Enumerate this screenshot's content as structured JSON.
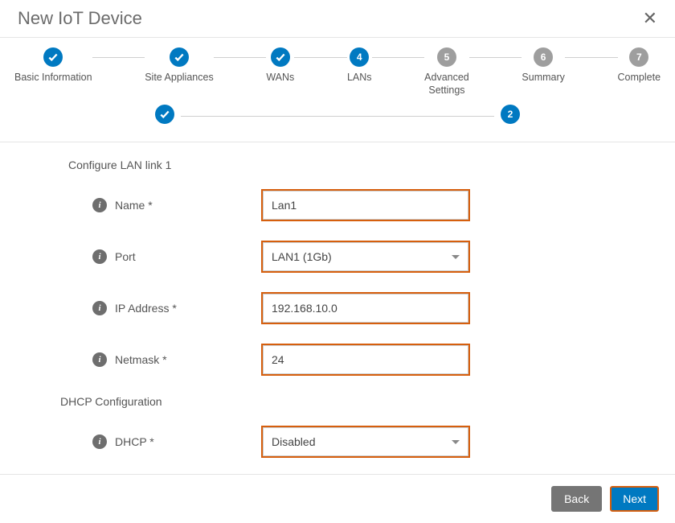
{
  "dialog": {
    "title": "New IoT Device"
  },
  "stepper": {
    "steps": [
      {
        "label": "Basic Information",
        "state": "done"
      },
      {
        "label": "Site Appliances",
        "state": "done"
      },
      {
        "label": "WANs",
        "state": "done"
      },
      {
        "label": "LANs",
        "state": "active",
        "number": "4"
      },
      {
        "label": "Advanced\nSettings",
        "state": "future",
        "number": "5"
      },
      {
        "label": "Summary",
        "state": "future",
        "number": "6"
      },
      {
        "label": "Complete",
        "state": "future",
        "number": "7"
      }
    ]
  },
  "sub_stepper": {
    "step1_state": "done",
    "step2_state": "active",
    "step2_number": "2"
  },
  "form": {
    "section_heading": "Configure LAN link 1",
    "name": {
      "label": "Name *",
      "value": "Lan1"
    },
    "port": {
      "label": "Port",
      "value": "LAN1 (1Gb)"
    },
    "ip": {
      "label": "IP Address *",
      "value": "192.168.10.0"
    },
    "netmask": {
      "label": "Netmask *",
      "value": "24"
    },
    "dhcp_heading": "DHCP Configuration",
    "dhcp": {
      "label": "DHCP *",
      "value": "Disabled"
    }
  },
  "footer": {
    "back": "Back",
    "next": "Next"
  }
}
